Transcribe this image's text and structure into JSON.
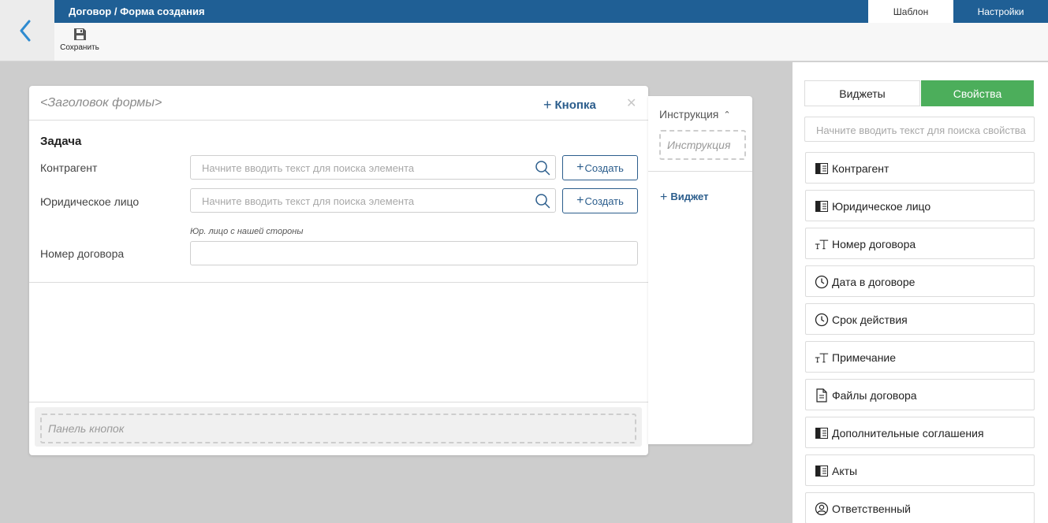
{
  "header": {
    "breadcrumb": "Договор / Форма создания",
    "tabs": {
      "template": "Шаблон",
      "settings": "Настройки"
    }
  },
  "toolbar": {
    "save_label": "Сохранить"
  },
  "form": {
    "title": "<Заголовок формы>",
    "add_button_label": "Кнопка",
    "section_title": "Задача",
    "fields": {
      "counterparty": {
        "label": "Контрагент",
        "placeholder": "Начните вводить текст для поиска элемента",
        "create_label": "Создать"
      },
      "legal_entity": {
        "label": "Юридическое лицо",
        "placeholder": "Начните вводить текст для поиска элемента",
        "create_label": "Создать",
        "hint": "Юр. лицо с нашей стороны"
      },
      "contract_number": {
        "label": "Номер договора",
        "value": ""
      }
    },
    "buttons_panel": "Панель кнопок"
  },
  "instruction": {
    "title": "Инструкция",
    "placeholder": "Инструкция",
    "add_widget_label": "Виджет"
  },
  "right_panel": {
    "tabs": {
      "widgets": "Виджеты",
      "properties": "Свойства"
    },
    "active_tab": "properties",
    "search_placeholder": "Начните вводить текст для поиска свойства",
    "items": [
      {
        "label": "Контрагент",
        "icon": "catalog-icon"
      },
      {
        "label": "Юридическое лицо",
        "icon": "catalog-icon"
      },
      {
        "label": "Номер договора",
        "icon": "text-icon"
      },
      {
        "label": "Дата в договоре",
        "icon": "clock-icon"
      },
      {
        "label": "Срок действия",
        "icon": "clock-icon"
      },
      {
        "label": "Примечание",
        "icon": "text-icon"
      },
      {
        "label": "Файлы договора",
        "icon": "file-icon"
      },
      {
        "label": "Дополнительные соглашения",
        "icon": "catalog-icon"
      },
      {
        "label": "Акты",
        "icon": "catalog-icon"
      },
      {
        "label": "Ответственный",
        "icon": "user-icon"
      }
    ]
  },
  "colors": {
    "header_blue": "#1f5f95",
    "accent_green": "#4cae5b",
    "link_blue": "#2b5d8c"
  }
}
